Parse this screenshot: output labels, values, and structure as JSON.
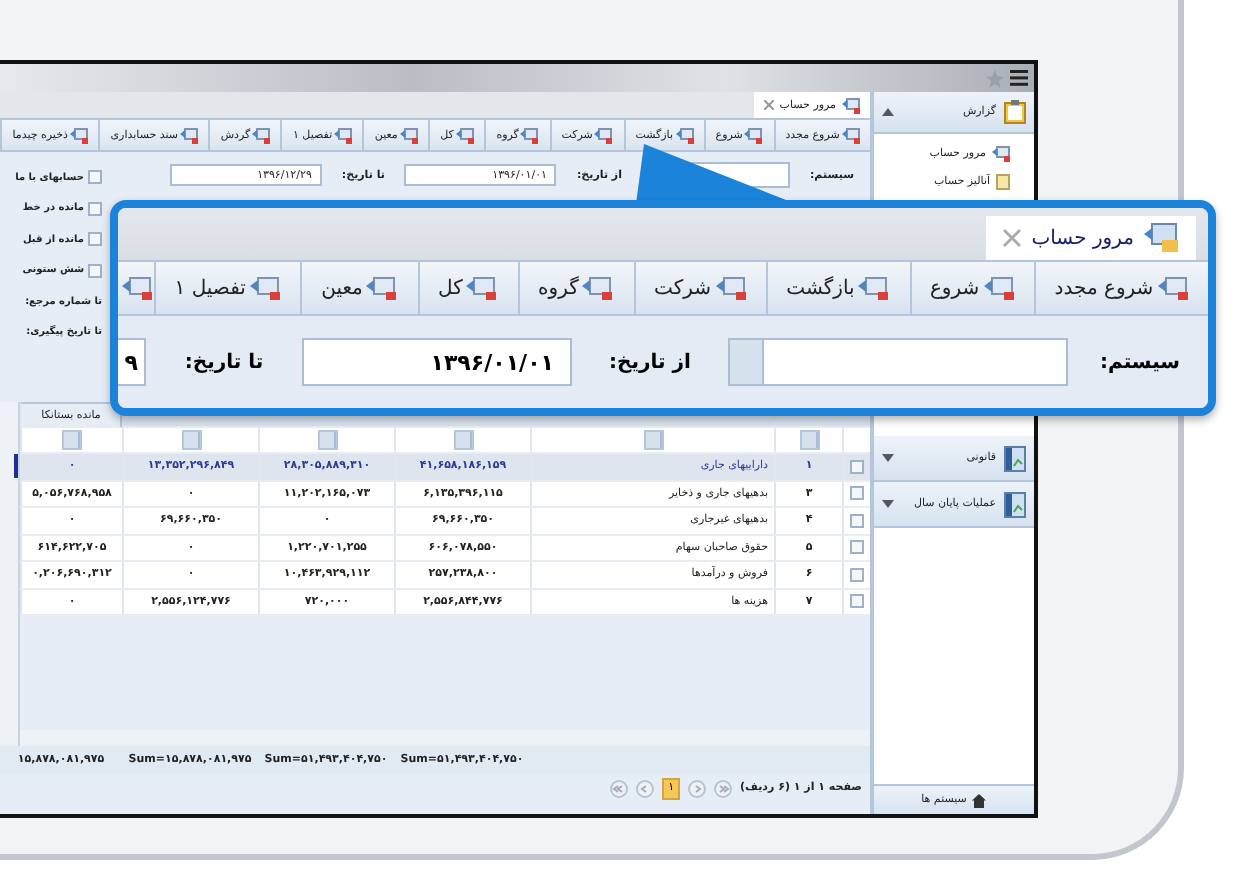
{
  "tab": {
    "title": "مرور حساب",
    "selected": true
  },
  "toolbar": [
    "شروع مجدد",
    "شروع",
    "بازگشت",
    "شرکت",
    "گروه",
    "کل",
    "معین",
    "تفصیل ۱",
    "گردش",
    "سند حسابداری",
    "ذخیره چیدما"
  ],
  "form": {
    "system_label": "سیستم:",
    "from_label": "از تاریخ:",
    "from_value": "۱۳۹۶/۰۱/۰۱",
    "to_label": "تا تاریخ:",
    "to_value": "۱۳۹۶/۱۲/۲۹"
  },
  "options": [
    {
      "kind": "checkbox",
      "label": "حسابهای با ما",
      "checked": false
    },
    {
      "kind": "checkbox",
      "label": "مانده در خط",
      "checked": false
    },
    {
      "kind": "checkbox",
      "label": "مانده از قبل",
      "checked": false
    },
    {
      "kind": "checkbox",
      "label": "شش ستونی",
      "checked": false
    },
    {
      "kind": "label",
      "label": "تا شماره مرجع:"
    },
    {
      "kind": "label",
      "label": "تا تاریخ پیگیری:"
    }
  ],
  "grid": {
    "column_6_header": "مانده بستانکا",
    "rows": [
      {
        "number": "۱",
        "title": "دارایيهای جاری",
        "values": [
          "۴۱,۶۵۸,۱۸۶,۱۵۹",
          "۲۸,۳۰۵,۸۸۹,۳۱۰",
          "۱۳,۳۵۲,۲۹۶,۸۴۹",
          "۰"
        ],
        "selected": true,
        "checked": false
      },
      {
        "number": "۳",
        "title": "بدهیهای جاری و ذخایر",
        "values": [
          "۶,۱۳۵,۳۹۶,۱۱۵",
          "۱۱,۲۰۲,۱۶۵,۰۷۳",
          "۰",
          "۵,۰۵۶,۷۶۸,۹۵۸"
        ],
        "selected": false,
        "checked": false
      },
      {
        "number": "۴",
        "title": "بدهیهای غیرجاری",
        "values": [
          "۶۹,۶۶۰,۳۵۰",
          "۰",
          "۶۹,۶۶۰,۳۵۰",
          "۰"
        ],
        "selected": false,
        "checked": false
      },
      {
        "number": "۵",
        "title": "حقوق صاحبان سهام",
        "values": [
          "۶۰۶,۰۷۸,۵۵۰",
          "۱,۲۲۰,۷۰۱,۲۵۵",
          "۰",
          "۶۱۴,۶۲۲,۷۰۵"
        ],
        "selected": false,
        "checked": false
      },
      {
        "number": "۶",
        "title": "فروش و درآمدها",
        "values": [
          "۲۵۷,۲۳۸,۸۰۰",
          "۱۰,۴۶۳,۹۲۹,۱۱۲",
          "۰",
          "۰,۲۰۶,۶۹۰,۳۱۲"
        ],
        "selected": false,
        "checked": false
      },
      {
        "number": "۷",
        "title": "هزینه ها",
        "values": [
          "۲,۵۵۶,۸۴۴,۷۷۶",
          "۷۲۰,۰۰۰",
          "۲,۵۵۶,۱۲۴,۷۷۶",
          "۰"
        ],
        "selected": false,
        "checked": false
      }
    ],
    "sums": [
      "Sum=۵۱,۴۹۳,۴۰۴,۷۵۰",
      "Sum=۵۱,۴۹۳,۴۰۴,۷۵۰",
      "Sum=۱۵,۸۷۸,۰۸۱,۹۷۵",
      "۱۵,۸۷۸,۰۸۱,۹۷۵"
    ],
    "pager": {
      "summary": "صفحه ۱ از ۱ (۶ ردیف)",
      "pages": [
        {
          "label": "۱",
          "selected": true
        }
      ]
    }
  },
  "sidebar": {
    "group": {
      "title": "گزارش",
      "expanded": true,
      "items": [
        "مرور حساب",
        "آنالیز حساب"
      ]
    },
    "sections": [
      {
        "title": "قانونی",
        "expanded": false
      },
      {
        "title": "عملیات پایان سال",
        "expanded": false
      }
    ],
    "footer": "سیستم ها"
  },
  "callout": {
    "tab": {
      "title": "مرور حساب",
      "selected": true
    },
    "toolbar": [
      "شروع مجدد",
      "شروع",
      "بازگشت",
      "شرکت",
      "گروه",
      "کل",
      "معین",
      "تفصیل ۱"
    ],
    "system_label": "سیستم:",
    "from_label": "از تاریخ:",
    "from_value": "۱۳۹۶/۰۱/۰۱",
    "to_label": "تا تاریخ:",
    "to_value": "۹"
  }
}
